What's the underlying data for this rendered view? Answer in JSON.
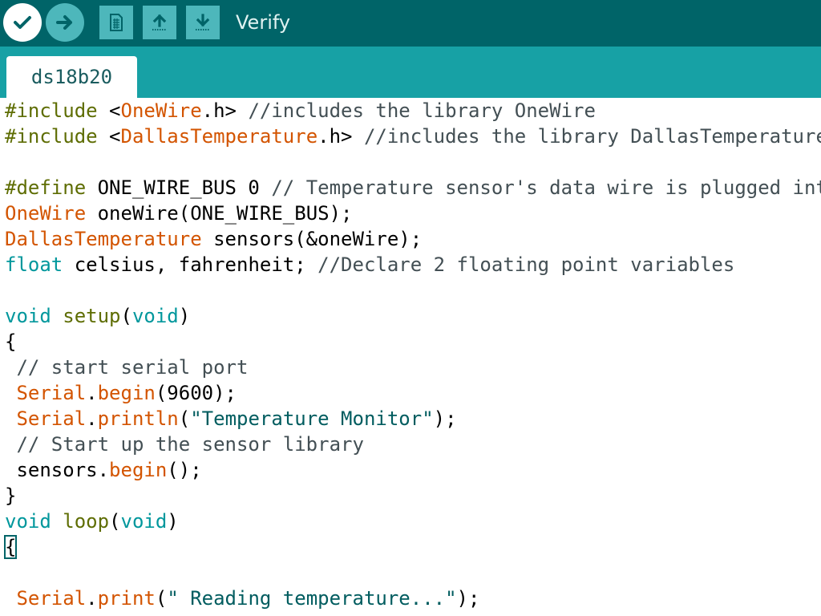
{
  "toolbar": {
    "status": "Verify",
    "buttons": [
      {
        "name": "verify-button",
        "icon": "checkmark-icon"
      },
      {
        "name": "upload-button",
        "icon": "arrow-right-icon"
      },
      {
        "name": "new-button",
        "icon": "new-sketch-icon"
      },
      {
        "name": "open-button",
        "icon": "open-arrow-up-icon"
      },
      {
        "name": "save-button",
        "icon": "save-arrow-down-icon"
      }
    ]
  },
  "tabs": [
    {
      "label": "ds18b20"
    }
  ],
  "editor": {
    "lines": [
      [
        [
          "t-pre",
          "#include "
        ],
        [
          "t-plain",
          "<"
        ],
        [
          "t-lib",
          "OneWire"
        ],
        [
          "t-plain",
          ".h> "
        ],
        [
          "t-comment",
          "//includes the library OneWire"
        ]
      ],
      [
        [
          "t-pre",
          "#include "
        ],
        [
          "t-plain",
          "<"
        ],
        [
          "t-lib",
          "DallasTemperature"
        ],
        [
          "t-plain",
          ".h> "
        ],
        [
          "t-comment",
          "//includes the library DallasTemperature"
        ]
      ],
      [],
      [
        [
          "t-pre",
          "#define "
        ],
        [
          "t-plain",
          "ONE_WIRE_BUS 0 "
        ],
        [
          "t-comment",
          "// Temperature sensor's data wire is plugged into"
        ]
      ],
      [
        [
          "t-lib",
          "OneWire"
        ],
        [
          "t-plain",
          " oneWire(ONE_WIRE_BUS);"
        ]
      ],
      [
        [
          "t-lib",
          "DallasTemperature"
        ],
        [
          "t-plain",
          " sensors(&oneWire);"
        ]
      ],
      [
        [
          "t-kw",
          "float"
        ],
        [
          "t-plain",
          " celsius, fahrenheit; "
        ],
        [
          "t-comment",
          "//Declare 2 floating point variables"
        ]
      ],
      [],
      [
        [
          "t-kw",
          "void"
        ],
        [
          "t-plain",
          " "
        ],
        [
          "t-fn",
          "setup"
        ],
        [
          "t-plain",
          "("
        ],
        [
          "t-kw",
          "void"
        ],
        [
          "t-plain",
          ")"
        ]
      ],
      [
        [
          "t-plain",
          "{"
        ]
      ],
      [
        [
          "t-comment",
          " // start serial port"
        ]
      ],
      [
        [
          "t-plain",
          " "
        ],
        [
          "t-lib",
          "Serial"
        ],
        [
          "t-plain",
          "."
        ],
        [
          "t-lib",
          "begin"
        ],
        [
          "t-plain",
          "(9600);"
        ]
      ],
      [
        [
          "t-plain",
          " "
        ],
        [
          "t-lib",
          "Serial"
        ],
        [
          "t-plain",
          "."
        ],
        [
          "t-lib",
          "println"
        ],
        [
          "t-plain",
          "("
        ],
        [
          "t-str",
          "\"Temperature Monitor\""
        ],
        [
          "t-plain",
          ");"
        ]
      ],
      [
        [
          "t-comment",
          " // Start up the sensor library"
        ]
      ],
      [
        [
          "t-plain",
          " sensors."
        ],
        [
          "t-lib",
          "begin"
        ],
        [
          "t-plain",
          "();"
        ]
      ],
      [
        [
          "t-plain",
          "}"
        ]
      ],
      [
        [
          "t-kw",
          "void"
        ],
        [
          "t-plain",
          " "
        ],
        [
          "t-fn",
          "loop"
        ],
        [
          "t-plain",
          "("
        ],
        [
          "t-kw",
          "void"
        ],
        [
          "t-plain",
          ")"
        ]
      ],
      [
        [
          "t-plain cursor-brace",
          "{"
        ]
      ],
      [],
      [
        [
          "t-plain",
          " "
        ],
        [
          "t-lib",
          "Serial"
        ],
        [
          "t-plain",
          "."
        ],
        [
          "t-lib",
          "print"
        ],
        [
          "t-plain",
          "("
        ],
        [
          "t-str",
          "\" Reading temperature...\""
        ],
        [
          "t-plain",
          ");"
        ]
      ]
    ]
  }
}
